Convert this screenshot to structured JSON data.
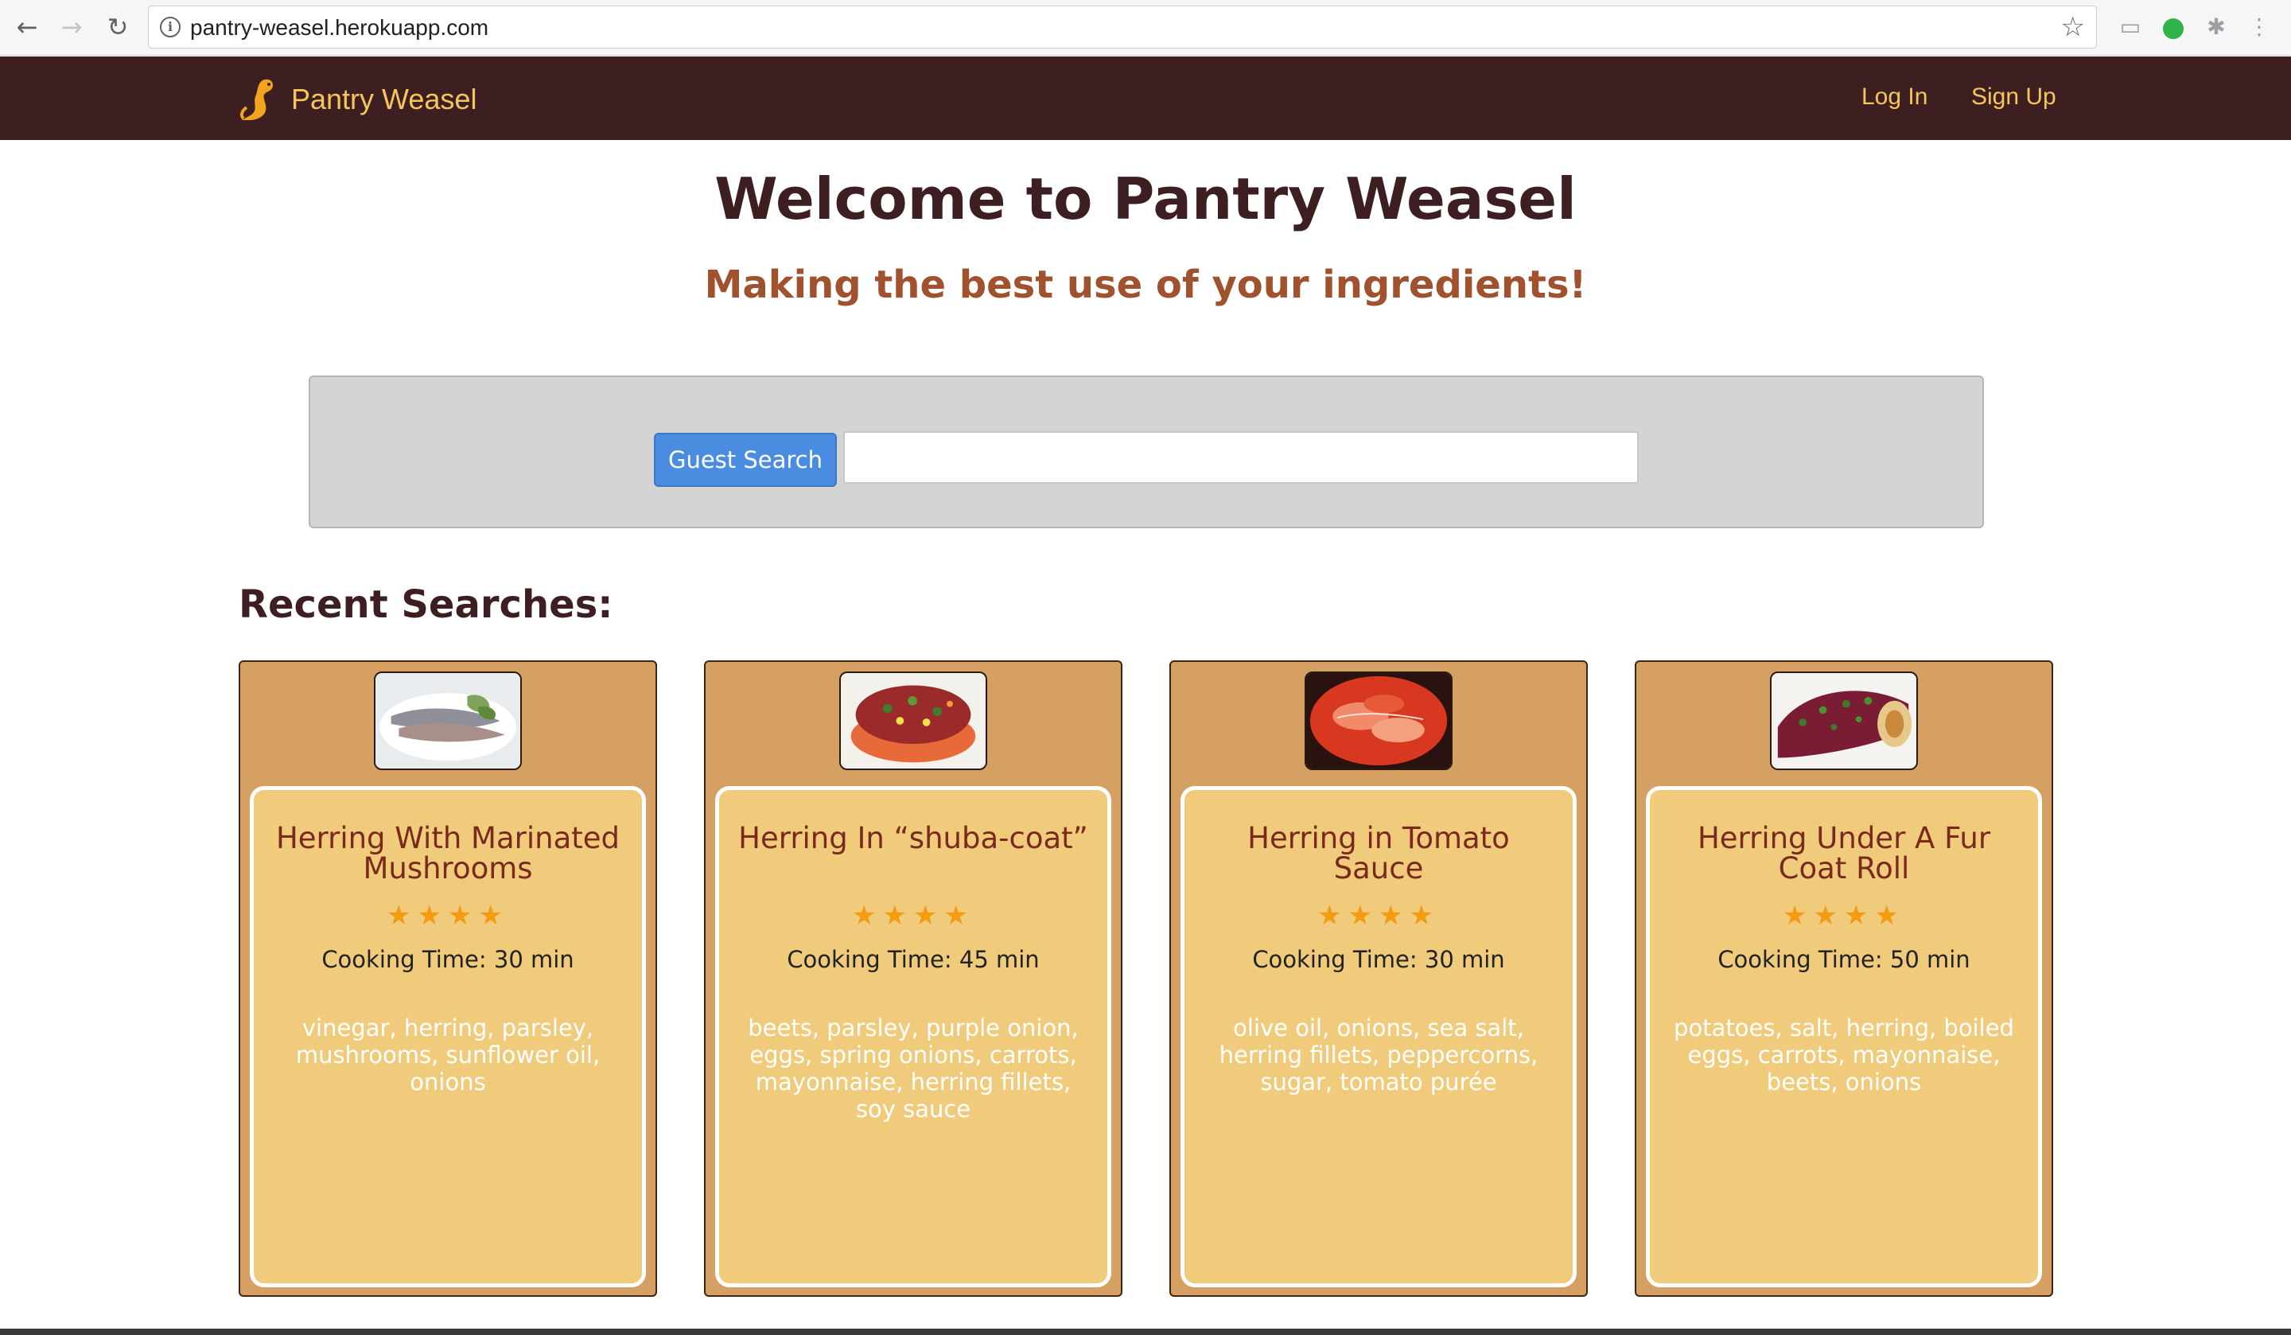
{
  "browser": {
    "url": "pantry-weasel.herokuapp.com",
    "back_icon": "arrow-left",
    "forward_icon": "arrow-right",
    "reload_icon": "reload",
    "info_icon": "info-circle",
    "bookmark_icon": "star-outline"
  },
  "navbar": {
    "brand_name": "Pantry Weasel",
    "logo_icon": "weasel-logo",
    "login_label": "Log In",
    "signup_label": "Sign Up",
    "background_color": "#3d1f22",
    "accent_color": "#f4c65b"
  },
  "hero": {
    "title": "Welcome to Pantry Weasel",
    "subtitle": "Making the best use of your ingredients!"
  },
  "search": {
    "button_label": "Guest Search",
    "input_value": "",
    "input_placeholder": ""
  },
  "recent": {
    "heading": "Recent Searches:",
    "cards": [
      {
        "name": "Herring With Marinated Mushrooms",
        "stars": "★★★★",
        "rating": 4,
        "cooking_time": "Cooking Time: 30 min",
        "ingredients": "vinegar, herring, parsley, mushrooms, sunflower oil, onions"
      },
      {
        "name": "Herring In “shuba-coat”",
        "stars": "★★★★",
        "rating": 4,
        "cooking_time": "Cooking Time: 45 min",
        "ingredients": "beets, parsley, purple onion, eggs, spring onions, carrots, mayonnaise, herring fillets, soy sauce"
      },
      {
        "name": "Herring in Tomato Sauce",
        "stars": "★★★★",
        "rating": 4,
        "cooking_time": "Cooking Time: 30 min",
        "ingredients": "olive oil, onions, sea salt, herring fillets, peppercorns, sugar, tomato purée"
      },
      {
        "name": "Herring Under A Fur Coat Roll",
        "stars": "★★★★",
        "rating": 4,
        "cooking_time": "Cooking Time: 50 min",
        "ingredients": "potatoes, salt, herring, boiled eggs, carrots, mayonnaise, beets, onions"
      }
    ]
  }
}
